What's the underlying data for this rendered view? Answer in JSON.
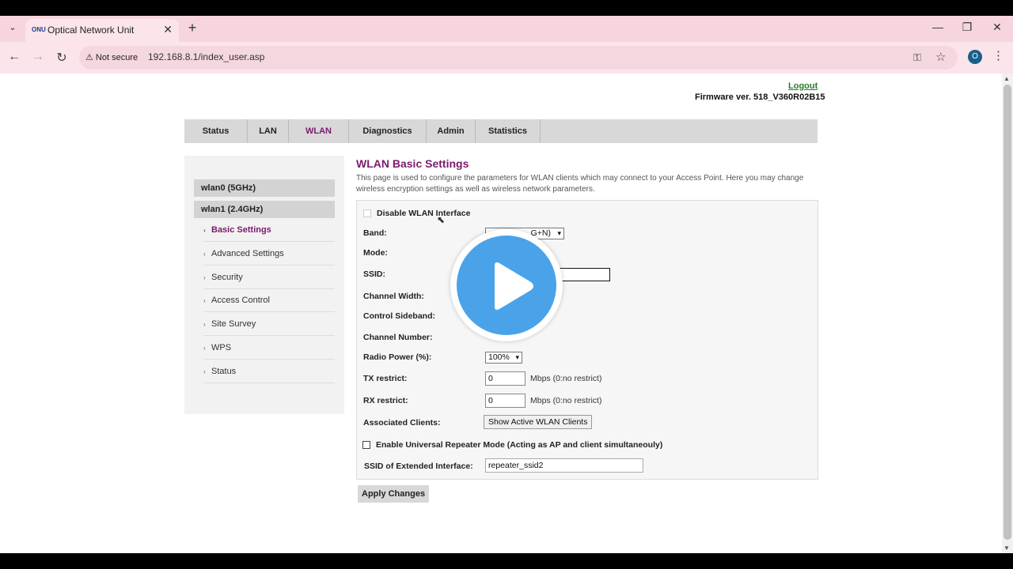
{
  "browser": {
    "tab_title": "Optical Network Unit",
    "tab_favicon_text": "ONU",
    "security_label": "Not secure",
    "url": "192.168.8.1/index_user.asp",
    "profile_initial": "O"
  },
  "header": {
    "logout": "Logout",
    "firmware": "Firmware ver. 518_V360R02B15"
  },
  "menu": [
    {
      "label": "Status"
    },
    {
      "label": "LAN"
    },
    {
      "label": "WLAN"
    },
    {
      "label": "Diagnostics"
    },
    {
      "label": "Admin"
    },
    {
      "label": "Statistics"
    }
  ],
  "sidebar": {
    "groups": [
      "wlan0 (5GHz)",
      "wlan1 (2.4GHz)"
    ],
    "items": [
      {
        "label": "Basic Settings"
      },
      {
        "label": "Advanced Settings"
      },
      {
        "label": "Security"
      },
      {
        "label": "Access Control"
      },
      {
        "label": "Site Survey"
      },
      {
        "label": "WPS"
      },
      {
        "label": "Status"
      }
    ]
  },
  "main": {
    "title": "WLAN Basic Settings",
    "description": "This page is used to configure the parameters for WLAN clients which may connect to your Access Point. Here you may change wireless encryption settings as well as wireless network parameters.",
    "disable_label": "Disable WLAN Interface",
    "band_label": "Band:",
    "band_value": "G+N)",
    "mode_label": "Mode:",
    "ssid_label": "SSID:",
    "channel_width_label": "Channel Width:",
    "control_sideband_label": "Control Sideband:",
    "channel_number_label": "Channel Number:",
    "radio_power_label": "Radio Power (%):",
    "radio_power_value": "100%",
    "tx_label": "TX restrict:",
    "tx_value": "0",
    "tx_hint": "Mbps (0:no restrict)",
    "rx_label": "RX restrict:",
    "rx_value": "0",
    "rx_hint": "Mbps (0:no restrict)",
    "assoc_label": "Associated Clients:",
    "assoc_button": "Show Active WLAN Clients",
    "repeater_label": "Enable Universal Repeater Mode (Acting as AP and client simultaneouly)",
    "ext_ssid_label": "SSID of Extended Interface:",
    "ext_ssid_value": "repeater_ssid2",
    "apply_button": "Apply Changes"
  },
  "colors": {
    "accent": "#7b1a6b",
    "play": "#4aa3e8"
  }
}
